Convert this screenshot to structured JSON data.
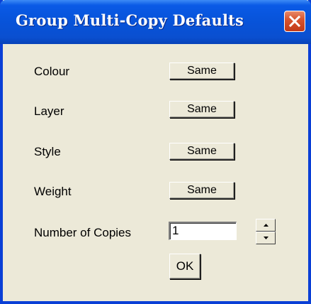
{
  "window": {
    "title": "Group Multi-Copy Defaults"
  },
  "fields": [
    {
      "label": "Colour",
      "button": "Same"
    },
    {
      "label": "Layer",
      "button": "Same"
    },
    {
      "label": "Style",
      "button": "Same"
    },
    {
      "label": "Weight",
      "button": "Same"
    }
  ],
  "copies": {
    "label": "Number of Copies",
    "value": "1"
  },
  "ok_label": "OK",
  "icons": {
    "close": "close-icon",
    "up": "spin-up-icon",
    "down": "spin-down-icon"
  },
  "colors": {
    "titlebar": "#0753d9",
    "close_button": "#d8552f",
    "dialog_bg": "#ece9d8"
  }
}
